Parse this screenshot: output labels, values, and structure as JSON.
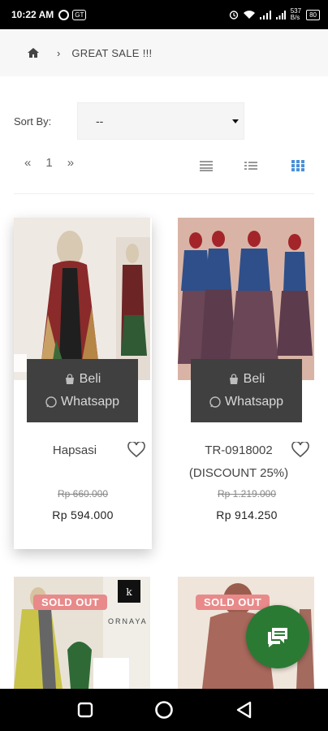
{
  "status_bar": {
    "time": "10:22 AM",
    "left_badge": "GT",
    "net_speed": "537",
    "net_unit": "B/s",
    "battery": "80"
  },
  "breadcrumb": {
    "home_icon": "home-icon",
    "separator": "›",
    "current": "GREAT SALE !!!"
  },
  "sort": {
    "label": "Sort By:",
    "selected": "--"
  },
  "pager": {
    "prev": "«",
    "page": "1",
    "next": "»"
  },
  "view_modes": [
    "view-list-large-icon",
    "view-list-icon",
    "view-grid-icon"
  ],
  "products": [
    {
      "buy_label": "Beli",
      "whatsapp_label": "Whatsapp",
      "name": "Hapsasi",
      "old_price": "Rp 660.000",
      "price": "Rp 594.000"
    },
    {
      "buy_label": "Beli",
      "whatsapp_label": "Whatsapp",
      "name_line1": "TR-0918002",
      "name_line2": "(DISCOUNT 25%)",
      "old_price": "Rp 1.219.000",
      "price": "Rp 914.250"
    },
    {
      "badge": "SOLD OUT",
      "brand_text": "ORNAYA"
    },
    {
      "badge": "SOLD OUT"
    }
  ],
  "fab": {
    "icon": "chat-icon"
  },
  "colors": {
    "accent_green": "#2b7a34",
    "soldout_pink": "#e88a8a",
    "overlay_dark": "#404040",
    "grid_icon_blue": "#4a90d9"
  }
}
